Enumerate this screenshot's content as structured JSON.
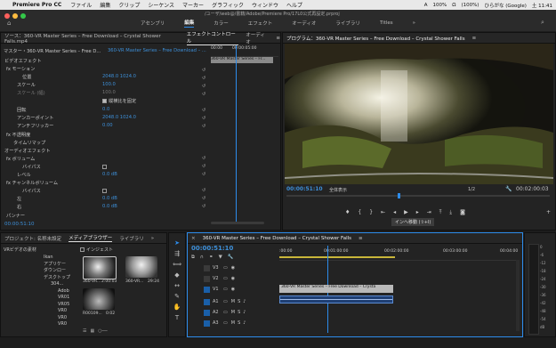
{
  "menubar": {
    "app": "Premiere Pro CC",
    "items": [
      "ファイル",
      "編集",
      "クリップ",
      "シーケンス",
      "マーカー",
      "グラフィック",
      "ウィンドウ",
      "ヘルプ"
    ],
    "status": [
      "A",
      "100%",
      "Ω",
      "(100%)",
      "ひらがな (Google)",
      "土 11:41"
    ]
  },
  "window": {
    "path": "/ユーザ/web@/書籍/Adobe/Premiere Pro/17L0公式再設定.prproj"
  },
  "workspaces": [
    "アセンブリ",
    "編集",
    "カラー",
    "エフェクト",
    "オーディオ",
    "ライブラリ",
    "Titles"
  ],
  "effect_controls": {
    "tabs": [
      "ソース：360-VR Master Series – Free Download – Crystal Shower Falls.mp4",
      "エフェクトコントロール",
      "オーディオ"
    ],
    "clip_selector": "マスター・360-VR Master Series – Free D...",
    "sequence_selector": "360-VR Master Series – Free Download – ...",
    "ruler": [
      "00:00",
      "00:00:05:00"
    ],
    "mini_clip_label": "360-VR Master Series – Fr...",
    "sections": {
      "video": "ビデオエフェクト",
      "audio": "オーディオエフェクト"
    },
    "rows": [
      {
        "label": "fx  モーション",
        "value": ""
      },
      {
        "label": "位置",
        "value": "2048.0   1024.0"
      },
      {
        "label": "スケール",
        "value": "100.0"
      },
      {
        "label": "スケール (幅)",
        "value": "100.0"
      },
      {
        "label": "縦横比を固定",
        "value": ""
      },
      {
        "label": "回転",
        "value": "0.0"
      },
      {
        "label": "アンカーポイント",
        "value": "2048.0   1024.0"
      },
      {
        "label": "アンチフリッカー",
        "value": "0.00"
      },
      {
        "label": "fx  不透明度",
        "value": ""
      },
      {
        "label": "タイムリマップ",
        "value": ""
      },
      {
        "label": "fx  ボリューム",
        "value": ""
      },
      {
        "label": "バイパス",
        "value": ""
      },
      {
        "label": "レベル",
        "value": "0.0 dB"
      },
      {
        "label": "fx  チャンネルボリューム",
        "value": ""
      },
      {
        "label": "バイパス",
        "value": ""
      },
      {
        "label": "左",
        "value": "0.0 dB"
      },
      {
        "label": "右",
        "value": "0.0 dB"
      },
      {
        "label": "パンナー",
        "value": ""
      }
    ],
    "timecode": "00:00:51:10"
  },
  "program": {
    "title": "プログラム：360-VR Master Series – Free Download – Crystal Shower Falls",
    "timecode": "00:00:51:10",
    "fit": "全体表示",
    "ratio": "1/2",
    "duration": "00:02:00:03",
    "tooltip": "インへ移動 (⇧+I)"
  },
  "project": {
    "tabs": [
      "プロジェクト: 名称未設定",
      "メディアブラウザー",
      "ライブラリ"
    ],
    "favorites": "VRビデオの素材",
    "ingest": "インジェスト",
    "tree": [
      "Ikan",
      "アプリケー",
      "ダウンロー",
      "デスクトップ",
      "304...",
      "Adob",
      "VR01",
      "VR05",
      "VR0",
      "VR0",
      "VR0"
    ],
    "thumbs": [
      {
        "name": "360-VR...",
        "dur": "2:00:03"
      },
      {
        "name": "360-VR...",
        "dur": "29:24"
      },
      {
        "name": "R00109...",
        "dur": "0:02"
      }
    ]
  },
  "timeline": {
    "title": "360-VR Master Series – Free Download – Crystal Shower Falls",
    "timecode": "00:00:51:10",
    "ruler": [
      ":00:00",
      "00:01:00:00",
      "00:02:00:00",
      "00:03:00:00",
      "00:04:00"
    ],
    "video_tracks": [
      "V3",
      "V2",
      "V1"
    ],
    "audio_tracks": [
      "A1",
      "A2",
      "A3"
    ],
    "clip_label": "360-VR Master Series – Free Download – Crysta",
    "meter": [
      "0",
      "-6",
      "-12",
      "-18",
      "-24",
      "-30",
      "-36",
      "-42",
      "-48",
      "-54",
      "dB"
    ]
  }
}
